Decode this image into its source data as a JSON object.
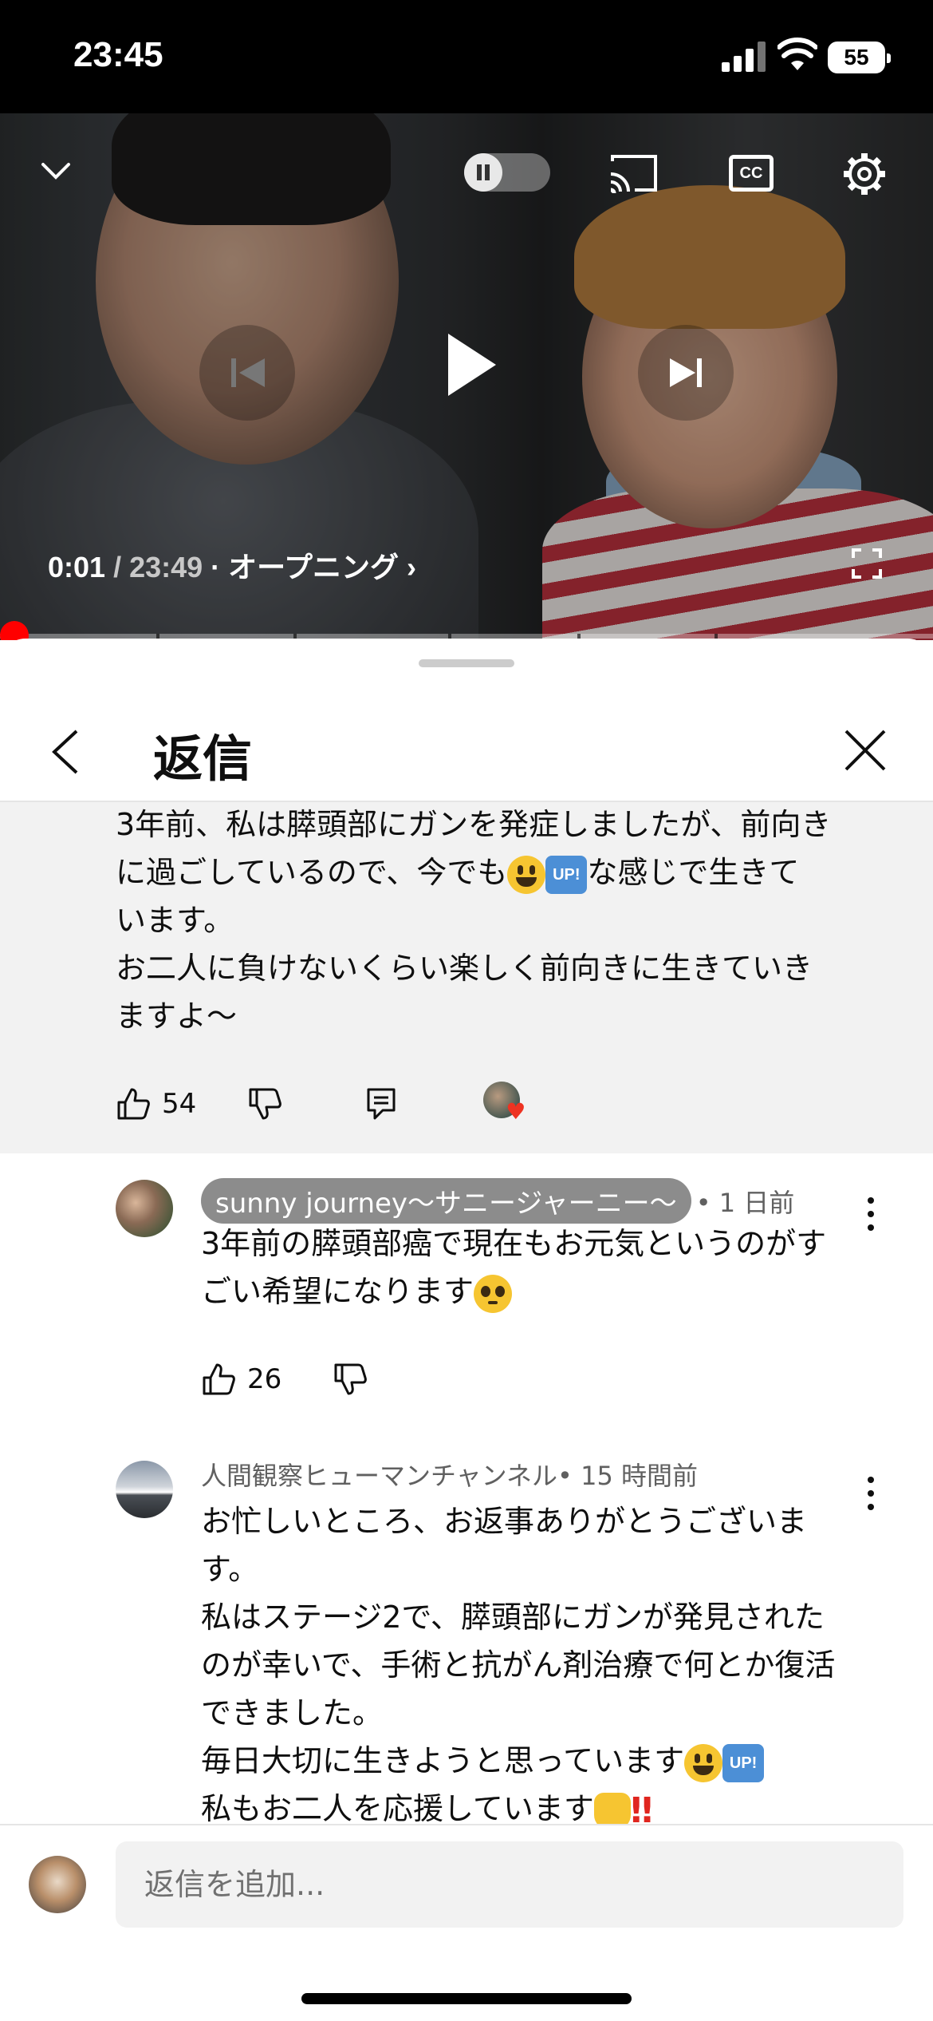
{
  "status_bar": {
    "time": "23:45",
    "battery": "55"
  },
  "video": {
    "current_time": "0:01",
    "separator": " / ",
    "duration": "23:49",
    "chapter": " · オープニング ›",
    "progress_fraction": 0.0
  },
  "sheet": {
    "title": "返信"
  },
  "parent_comment": {
    "text_line1": "3年前、私は膵頭部にガンを発症しましたが、前向き",
    "text_line2a": "に過ごしているので、今でも",
    "text_line2b": "な感じで生きて",
    "text_line3": "います。",
    "text_line4": "お二人に負けないくらい楽しく前向きに生きていき",
    "text_line5": "ますよ〜",
    "up_badge": "UP!",
    "likes": "54"
  },
  "replies": [
    {
      "author": "sunny journey〜サニージャーニー〜",
      "time": " • 1 日前",
      "text_a": "3年前の膵頭部癌で現在もお元気というのがす",
      "text_b": "ごい希望になります",
      "likes": "26"
    },
    {
      "author": "人間観察ヒューマンチャンネル",
      "time": " • 15 時間前",
      "text_1": "お忙しいところ、お返事ありがとうございま",
      "text_2": "す。",
      "text_3": "私はステージ2で、膵頭部にガンが発見された",
      "text_4": "のが幸いで、手術と抗がん剤治療で何とか復活",
      "text_5": "できました。",
      "text_6": "毎日大切に生きようと思っています",
      "text_7": "私もお二人を応援しています",
      "up_badge": "UP!"
    }
  ],
  "composer": {
    "placeholder": "返信を追加..."
  },
  "colors": {
    "accent_red": "#ff0000",
    "pill_gray": "#8c8c8c",
    "parent_bg": "#f2f2f2"
  }
}
